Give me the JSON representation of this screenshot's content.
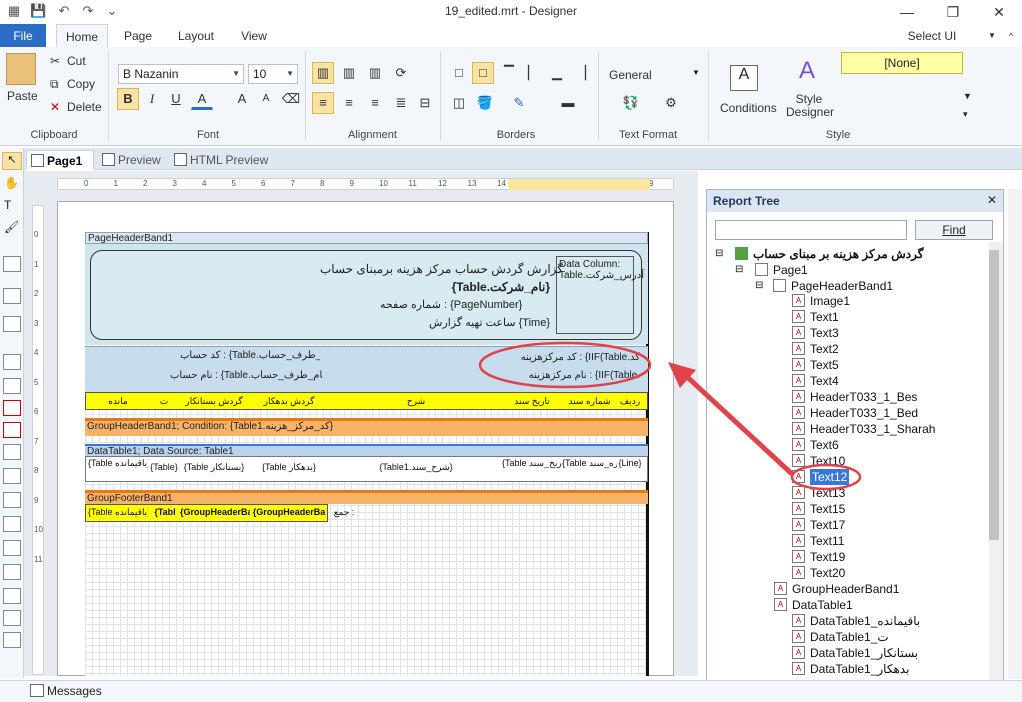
{
  "window": {
    "title": "19_edited.mrt - Designer"
  },
  "menu": {
    "file": "File",
    "tabs": [
      "Home",
      "Page",
      "Layout",
      "View"
    ],
    "ui_language": "Select UI Language"
  },
  "ribbon": {
    "clipboard": {
      "paste": "Paste",
      "cut": "Cut",
      "copy": "Copy",
      "delete": "Delete",
      "label": "Clipboard"
    },
    "font": {
      "name": "B Nazanin",
      "size": "10",
      "label": "Font",
      "bold": "B",
      "italic": "I",
      "underline": "U",
      "color": "A",
      "grow": "A",
      "shrink": "A"
    },
    "alignment": {
      "label": "Alignment"
    },
    "borders": {
      "label": "Borders"
    },
    "text_format": {
      "format": "General",
      "label": "Text Format"
    },
    "style": {
      "conditions": "Conditions",
      "style_designer": "Style Designer",
      "none": "[None]",
      "label": "Style"
    }
  },
  "doc_tabs": [
    "Page1",
    "Preview",
    "HTML Preview"
  ],
  "ruler": {
    "marks": [
      "0",
      "1",
      "2",
      "3",
      "4",
      "5",
      "6",
      "7",
      "8",
      "9",
      "10",
      "11",
      "12",
      "13",
      "14",
      "15",
      "16",
      "17",
      "18",
      "19"
    ],
    "vmarks": [
      "0",
      "1",
      "2",
      "3",
      "4",
      "5",
      "6",
      "7",
      "8",
      "9",
      "10",
      "11"
    ]
  },
  "report": {
    "page_header": "PageHeaderBand1",
    "title": "گزارش گردش حساب مرکز هزینه برمبنای حساب",
    "company": "{Table.نام_شرکت}",
    "page_number": "شماره صفحه : {PageNumber}",
    "time": "ساعت تهیه گزارش {Time}",
    "data_column": "Data Column: Table.آدرس_شرکت",
    "acc_code": "کد حساب : {Table.کد_طرف_حساب}",
    "acc_name": "نام حساب : {Table.نام_طرف_حساب}",
    "cc_code": "کد مرکزهزینه : {IIF(Table.کد",
    "cc_name": "نام مرکزهزینه : {IIF(Table.",
    "headers": [
      "ردیف",
      "شماره سند",
      "تاریخ سند",
      "شرح",
      "گردش بدهکار",
      "گردش بستانکار",
      "ت",
      "مانده"
    ],
    "group_header": "GroupHeaderBand1; Condition: {Table1.کد_مرکز_هزینه}",
    "data_band": "DataTable1; Data Source: Table1",
    "data_cells": [
      "{Line}",
      "{Table شماره_سند}",
      "{Table تاریخ_سند}",
      "{Table1.شرح_سند}",
      "{Table بدهکار}",
      "{Table بستانکار}",
      "{Table}",
      "{Table باقیمانده}"
    ],
    "group_footer": "GroupFooterBand1",
    "footer_cells": [
      "جمع :",
      "{GroupHeaderBa",
      "{GroupHeaderBand\\Table",
      "{Tabl",
      "{Table باقیمانده}"
    ]
  },
  "tree": {
    "title": "Report Tree",
    "find": "Find",
    "root": "گردش مرکز هزینه بر مبنای حساب",
    "page": "Page1",
    "page_header": "PageHeaderBand1",
    "items": [
      "Image1",
      "Text1",
      "Text3",
      "Text2",
      "Text5",
      "Text4",
      "HeaderT033_1_Bes",
      "HeaderT033_1_Bed",
      "HeaderT033_1_Sharah",
      "Text6",
      "Text10",
      "Text12",
      "Text13",
      "Text15",
      "Text17",
      "Text11",
      "Text19",
      "Text20"
    ],
    "selected": "Text12",
    "group_header": "GroupHeaderBand1",
    "data_table": "DataTable1",
    "dt_items": [
      "DataTable1_باقیمانده",
      "DataTable1_ت",
      "DataTable1_بستانکار",
      "DataTable1_بدهکار"
    ]
  },
  "status": {
    "messages": "Messages"
  },
  "colors": {
    "accent": "#2b6cc4",
    "band_blue": "#b9d3ee",
    "band_orange": "#f7b469",
    "header_yellow": "#ffff00",
    "highlight": "#e0434b"
  }
}
